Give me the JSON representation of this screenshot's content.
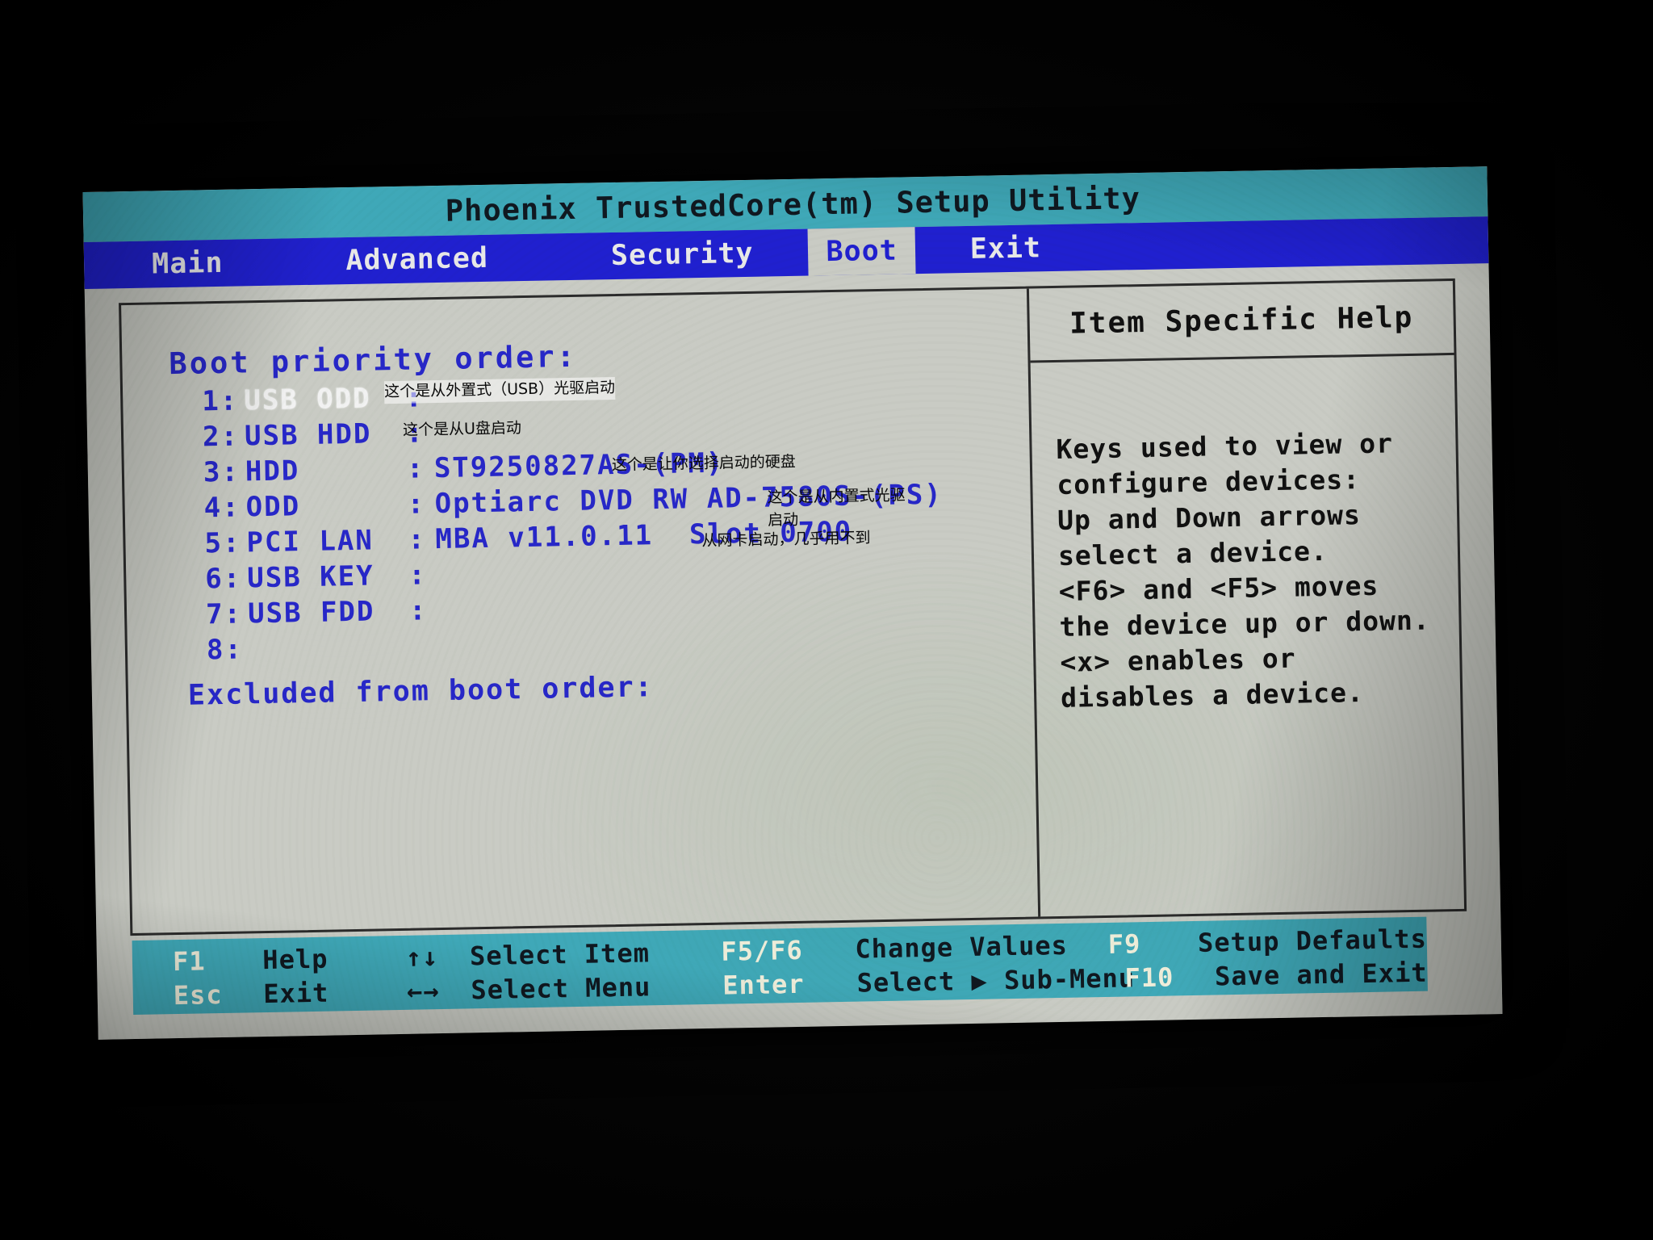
{
  "titlebar": {
    "title": "Phoenix TrustedCore(tm) Setup Utility"
  },
  "menu": {
    "items": [
      {
        "label": "Main",
        "selected": false
      },
      {
        "label": "Advanced",
        "selected": false
      },
      {
        "label": "Security",
        "selected": false
      },
      {
        "label": "Boot",
        "selected": true
      },
      {
        "label": "Exit",
        "selected": false
      }
    ]
  },
  "boot": {
    "section_title": "Boot priority order:",
    "excluded_title": "Excluded from boot order:",
    "rows": [
      {
        "index": "1:",
        "label": "USB ODD",
        "colon": ":",
        "value": "",
        "selected": true
      },
      {
        "index": "2:",
        "label": "USB HDD",
        "colon": ":",
        "value": "",
        "selected": false
      },
      {
        "index": "3:",
        "label": "HDD",
        "colon": ":",
        "value": "ST9250827AS-(PM)",
        "selected": false
      },
      {
        "index": "4:",
        "label": "ODD",
        "colon": ":",
        "value": "Optiarc DVD RW AD-7580S-(PS)",
        "selected": false
      },
      {
        "index": "5:",
        "label": "PCI LAN",
        "colon": ":",
        "value": "MBA v11.0.11  Slot 0700",
        "selected": false
      },
      {
        "index": "6:",
        "label": "USB KEY",
        "colon": ":",
        "value": "",
        "selected": false
      },
      {
        "index": "7:",
        "label": "USB FDD",
        "colon": ":",
        "value": "",
        "selected": false
      },
      {
        "index": "8:",
        "label": "",
        "colon": "",
        "value": "",
        "selected": false
      }
    ]
  },
  "annotations": [
    {
      "id": "usb-odd",
      "text": "这个是从外置式（USB）光驱启动"
    },
    {
      "id": "usb-hdd",
      "text": "这个是从U盘启动"
    },
    {
      "id": "hdd",
      "text": "这个是让你选择启动的硬盘"
    },
    {
      "id": "odd-l1",
      "text": "这个是从内置式光驱"
    },
    {
      "id": "odd-l2",
      "text": "启动"
    },
    {
      "id": "pci-lan",
      "text": "从网卡启动，几乎用不到"
    }
  ],
  "help": {
    "title": "Item Specific Help",
    "lines": [
      "Keys used to view or",
      "configure devices:",
      "Up and Down arrows",
      "select a device.",
      "<F6> and <F5> moves",
      "the device up or down.",
      "<x> enables or",
      "disables a device."
    ]
  },
  "legend": {
    "row1": [
      {
        "key": "F1",
        "desc": "Help"
      },
      {
        "key": "↑↓",
        "desc": "Select Item"
      },
      {
        "key": "F5/F6",
        "desc": "Change Values"
      },
      {
        "key": "F9",
        "desc": "Setup Defaults"
      }
    ],
    "row2": [
      {
        "key": "Esc",
        "desc": "Exit"
      },
      {
        "key": "←→",
        "desc": "Select Menu"
      },
      {
        "key": "Enter",
        "desc": "Select ▶ Sub-Menu"
      },
      {
        "key": "F10",
        "desc": "Save and Exit"
      }
    ]
  },
  "colors": {
    "title_bar": "#3fa8b8",
    "menu_bar": "#2020cf",
    "screen_bg": "#c9cbc4",
    "bios_blue_text": "#2727c8",
    "selected_text": "#f2f2f2"
  }
}
